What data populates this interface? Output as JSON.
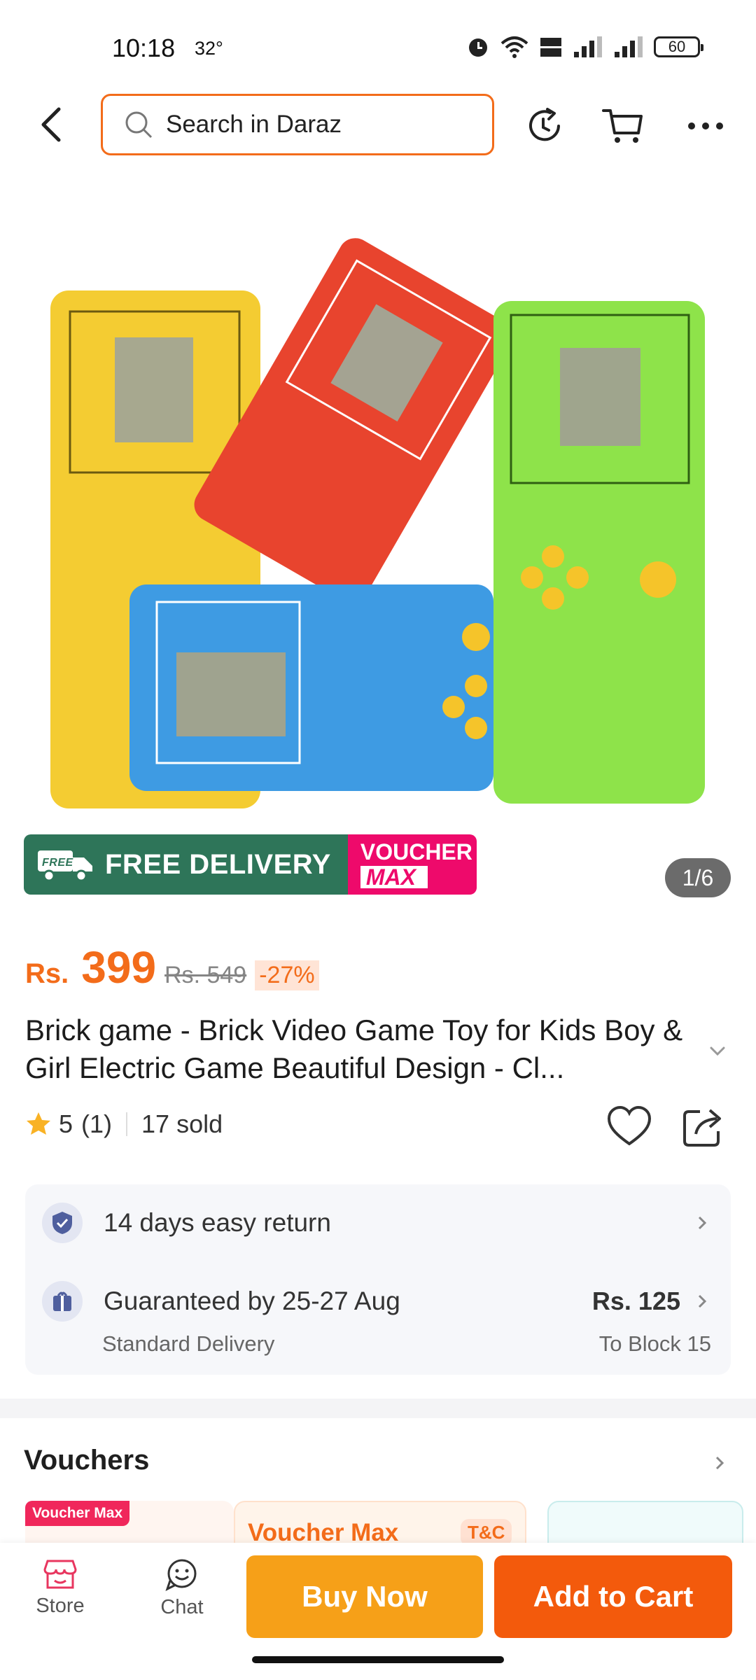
{
  "status_bar": {
    "time": "10:18",
    "temp": "32°",
    "battery": "60"
  },
  "search": {
    "placeholder": "Search in Daraz"
  },
  "product": {
    "image_counter": "1/6",
    "badge_free": "FREE DELIVERY",
    "badge_free_icon_text": "FREE",
    "badge_voucher_1": "VOUCHER",
    "badge_voucher_2": "MAX",
    "currency": "Rs.",
    "price": "399",
    "old_price": "Rs. 549",
    "discount": "-27%",
    "title": "Brick game - Brick Video Game Toy for Kids Boy & Girl Electric Game Beautiful Design - Cl...",
    "rating": "5",
    "rating_count": "(1)",
    "sold": "17 sold"
  },
  "service": {
    "return": "14 days easy return",
    "guarantee": "Guaranteed by 25-27 Aug",
    "delivery_type": "Standard Delivery",
    "delivery_fee": "Rs. 125",
    "delivery_to": "To Block 15"
  },
  "vouchers": {
    "title": "Vouchers",
    "tag": "Voucher Max",
    "card_title": "Voucher Max",
    "tc": "T&C"
  },
  "bottom": {
    "store": "Store",
    "chat": "Chat",
    "buy_now": "Buy Now",
    "add_to_cart": "Add to Cart"
  }
}
